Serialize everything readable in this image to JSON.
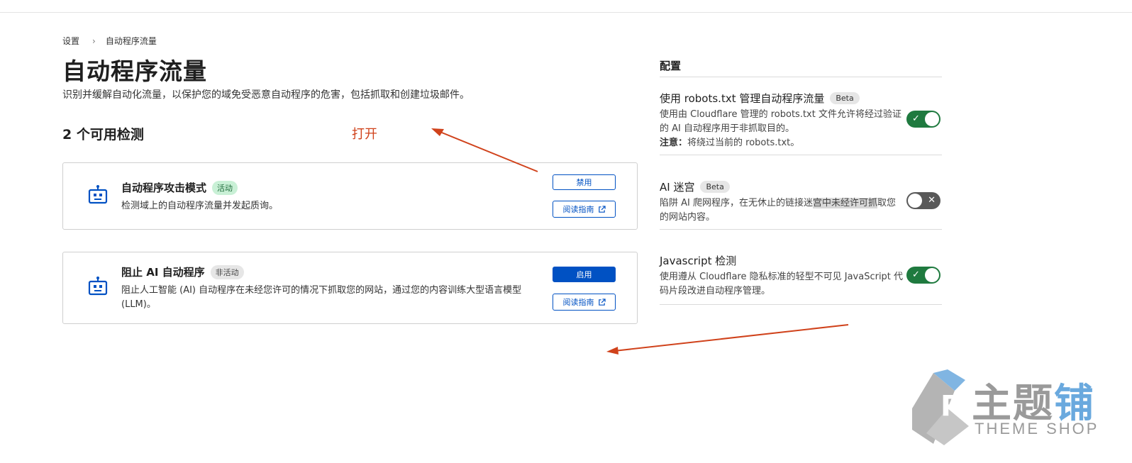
{
  "breadcrumb": {
    "root": "设置",
    "separator": "›",
    "current": "自动程序流量"
  },
  "page": {
    "title": "自动程序流量",
    "description": "识别并缓解自动化流量，以保护您的域免受恶意自动程序的危害，包括抓取和创建垃圾邮件。"
  },
  "detections": {
    "heading": "2 个可用检测",
    "annotation": "打开",
    "cards": [
      {
        "name": "自动程序攻击模式",
        "status": "活动",
        "description": "检测域上的自动程序流量并发起质询。",
        "primary_button": "禁用",
        "guide_button": "阅读指南"
      },
      {
        "name": "阻止 AI 自动程序",
        "status": "非活动",
        "description": "阻止人工智能 (AI) 自动程序在未经您许可的情况下抓取您的网站，通过您的内容训练大型语言模型 (LLM)。",
        "primary_button": "启用",
        "guide_button": "阅读指南"
      }
    ]
  },
  "config": {
    "title": "配置",
    "settings": [
      {
        "name": "使用 robots.txt 管理自动程序流量",
        "badge": "Beta",
        "description": "使用由 Cloudflare 管理的 robots.txt 文件允许将经过验证的 AI 自动程序用于非抓取目的。",
        "note_label": "注意：",
        "note_text": "将绕过当前的 robots.txt。",
        "enabled": true
      },
      {
        "name": "AI 迷宫",
        "badge": "Beta",
        "description_pre": "陷阱 AI 爬网程序，在无休止的链接迷",
        "description_highlight": "宫中未经许可抓",
        "description_post": "取您的网站内容。",
        "enabled": false
      },
      {
        "name": "Javascript 检测",
        "description": "使用遵从 Cloudflare 隐私标准的轻型不可见 JavaScript 代码片段改进自动程序管理。",
        "enabled": true
      }
    ]
  },
  "watermark": {
    "brand": "主题铺",
    "brand_main": "主题",
    "brand_last": "铺",
    "sub": "THEME SHOP"
  },
  "colors": {
    "accent": "#0051c3",
    "toggle_on": "#1f7a3f",
    "toggle_off": "#595959",
    "annotation": "#d0421b",
    "active_badge_bg": "#c9f0d6"
  },
  "icons": [
    "robot-icon",
    "external-link-icon",
    "check-icon",
    "x-icon",
    "chevron-right-icon"
  ]
}
